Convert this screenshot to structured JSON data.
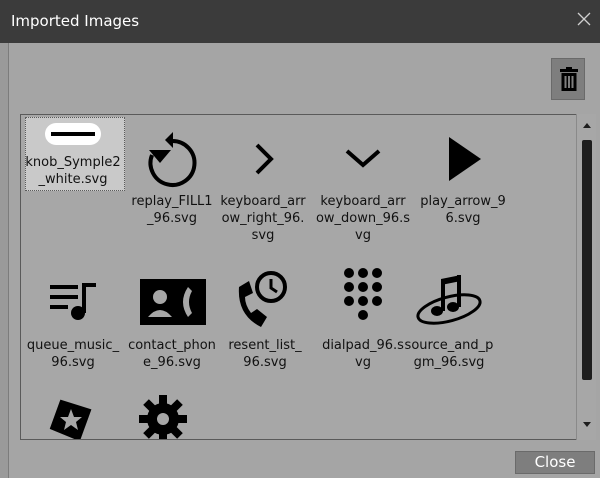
{
  "window": {
    "title": "Imported Images"
  },
  "toolbar": {
    "delete_icon": "trash-icon"
  },
  "footer": {
    "close_label": "Close"
  },
  "images": [
    {
      "label": "knob_Symple2_white.svg",
      "display": "knob_Symple2\n_white.svg",
      "icon": "knob-icon",
      "selected": true
    },
    {
      "label": "replay_FILL1_96.svg",
      "display": "replay_FILL1\n_96.svg",
      "icon": "replay-icon"
    },
    {
      "label": "keyboard_arrow_right_96.svg",
      "display": "keyboard_arr\now_right_96.\nsvg",
      "icon": "chevron-right-icon"
    },
    {
      "label": "keyboard_arrow_down_96.svg",
      "display": "keyboard_arr\now_down_96.s\nvg",
      "icon": "chevron-down-icon"
    },
    {
      "label": "play_arrow_96.svg",
      "display": "play_arrow_9\n6.svg",
      "icon": "play-arrow-icon"
    },
    {
      "label": "queue_music_96.svg",
      "display": "queue_music_\n96.svg",
      "icon": "queue-music-icon"
    },
    {
      "label": "contact_phone_96.svg",
      "display": "contact_phon\ne_96.svg",
      "icon": "contact-phone-icon"
    },
    {
      "label": "resent_list_96.svg",
      "display": "resent_list_\n96.svg",
      "icon": "recent-calls-icon"
    },
    {
      "label": "dialpad_96.svg",
      "display": "dialpad_96.s\nvg",
      "icon": "dialpad-icon"
    },
    {
      "label": "source_and_pgm_96.svg",
      "display": "source_and_p\ngm_96.svg",
      "icon": "music-note-icon"
    },
    {
      "label": "",
      "display": "",
      "icon": "star-badge-icon"
    },
    {
      "label": "",
      "display": "",
      "icon": "settings-gear-icon"
    }
  ]
}
